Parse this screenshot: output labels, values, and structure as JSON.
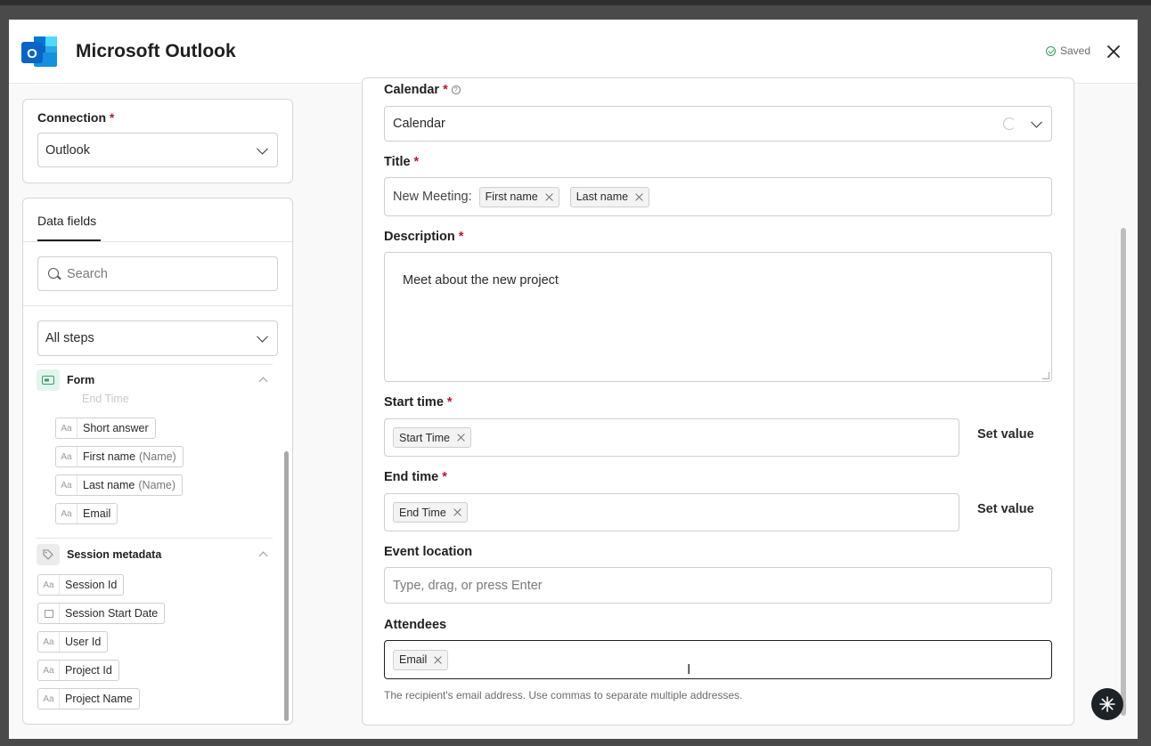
{
  "header": {
    "title": "Microsoft Outlook",
    "saved_label": "Saved",
    "logo_letter": "O"
  },
  "connection": {
    "label": "Connection",
    "required_mark": "*",
    "value": "Outlook"
  },
  "data_fields": {
    "tab_label": "Data fields",
    "search_placeholder": "Search",
    "steps_value": "All steps",
    "groups": {
      "form": {
        "label": "Form",
        "clipped_item": "End Time",
        "items": [
          {
            "label": "Short answer",
            "suffix": ""
          },
          {
            "label": "First name",
            "suffix": "(Name)"
          },
          {
            "label": "Last name",
            "suffix": "(Name)"
          },
          {
            "label": "Email",
            "suffix": ""
          }
        ]
      },
      "session": {
        "label": "Session metadata",
        "items": [
          {
            "label": "Session Id",
            "icon": "Aa"
          },
          {
            "label": "Session Start Date",
            "icon": "calendar"
          },
          {
            "label": "User Id",
            "icon": "Aa"
          },
          {
            "label": "Project Id",
            "icon": "Aa"
          },
          {
            "label": "Project Name",
            "icon": "Aa"
          }
        ]
      }
    },
    "type_icon": "Aa"
  },
  "form": {
    "calendar": {
      "label": "Calendar",
      "value": "Calendar"
    },
    "title": {
      "label": "Title",
      "prefix": "New Meeting:",
      "tokens": [
        "First name",
        "Last name"
      ]
    },
    "description": {
      "label": "Description",
      "value": "Meet about the new project"
    },
    "start_time": {
      "label": "Start time",
      "token": "Start Time",
      "action": "Set value"
    },
    "end_time": {
      "label": "End time",
      "token": "End Time",
      "action": "Set value"
    },
    "event_location": {
      "label": "Event location",
      "placeholder": "Type, drag, or press Enter"
    },
    "attendees": {
      "label": "Attendees",
      "token": "Email",
      "hint": "The recipient's email address. Use commas to separate multiple addresses."
    }
  },
  "colors": {
    "outlook_blue": "#0a64c8",
    "required": "#c0152a",
    "saved_green": "#3a9a5a",
    "form_badge": "#e2f5ec",
    "session_badge": "#ececec"
  }
}
